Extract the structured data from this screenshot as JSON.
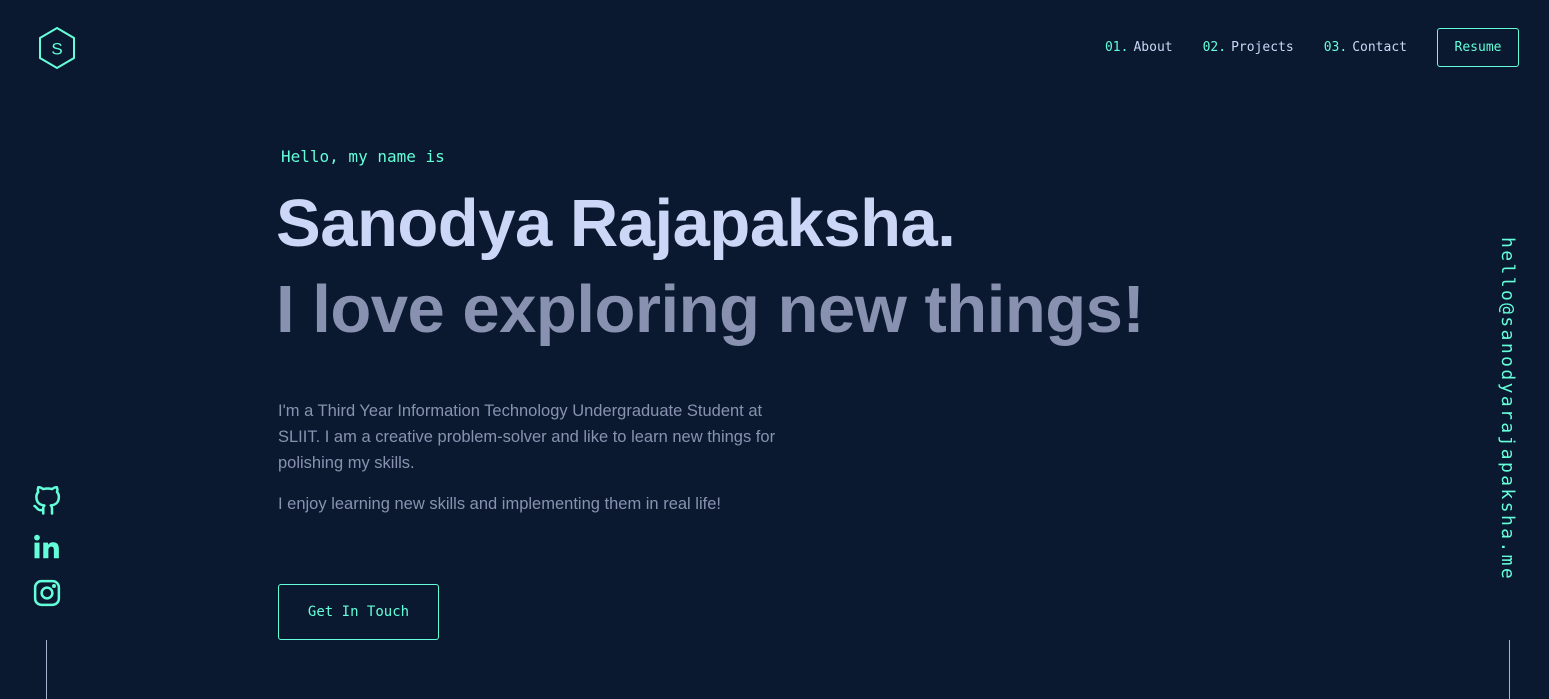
{
  "logo": {
    "letter": "S",
    "icon": "hexagon-logo-icon"
  },
  "nav": {
    "items": [
      {
        "num": "01.",
        "label": "About"
      },
      {
        "num": "02.",
        "label": "Projects"
      },
      {
        "num": "03.",
        "label": "Contact"
      }
    ],
    "resume_label": "Resume"
  },
  "hero": {
    "greeting": "Hello, my name is",
    "name": "Sanodya Rajapaksha.",
    "tagline": "I love exploring new things!",
    "bio": "I'm a Third Year Information Technology Undergraduate Student at SLIIT. I am a creative problem-solver and like to learn new things for polishing my skills.",
    "bio2": "I enjoy learning new skills and implementing them in real life!",
    "cta_label": "Get In Touch"
  },
  "social": {
    "icons": [
      "github-icon",
      "linkedin-icon",
      "instagram-icon"
    ]
  },
  "email": "hello@sanodyarajapaksha.me",
  "colors": {
    "background": "#0a192f",
    "accent": "#64ffda",
    "heading": "#ccd6f6",
    "body": "#8892b0",
    "line": "#a8b2d1"
  }
}
